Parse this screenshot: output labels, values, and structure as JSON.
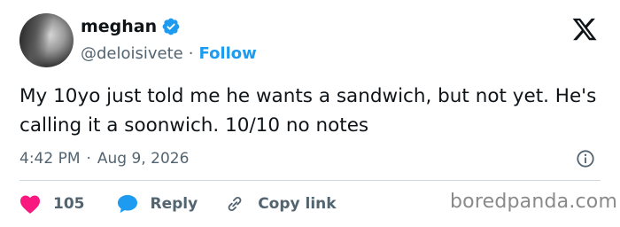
{
  "author": {
    "display_name": "meghan",
    "handle": "@deloisivete",
    "separator": "·",
    "follow_label": "Follow"
  },
  "tweet": {
    "text": "My 10yo just told me he wants a sandwich, but not yet. He's calling it a soonwich. 10/10 no notes",
    "time": "4:42 PM",
    "separator": "·",
    "date": "Aug 9, 2026"
  },
  "actions": {
    "like_count": "105",
    "reply_label": "Reply",
    "copy_link_label": "Copy link"
  },
  "watermark": "boredpanda.com",
  "icons": {
    "verified": "verified-badge-icon",
    "platform": "x-logo-icon",
    "info": "info-icon",
    "like": "heart-icon",
    "reply": "speech-bubble-icon",
    "copy": "link-icon"
  },
  "colors": {
    "accent_blue": "#1d9bf0",
    "like_red": "#f91880",
    "text_primary": "#0f1419",
    "text_secondary": "#536471",
    "divider": "#cfd9de"
  }
}
